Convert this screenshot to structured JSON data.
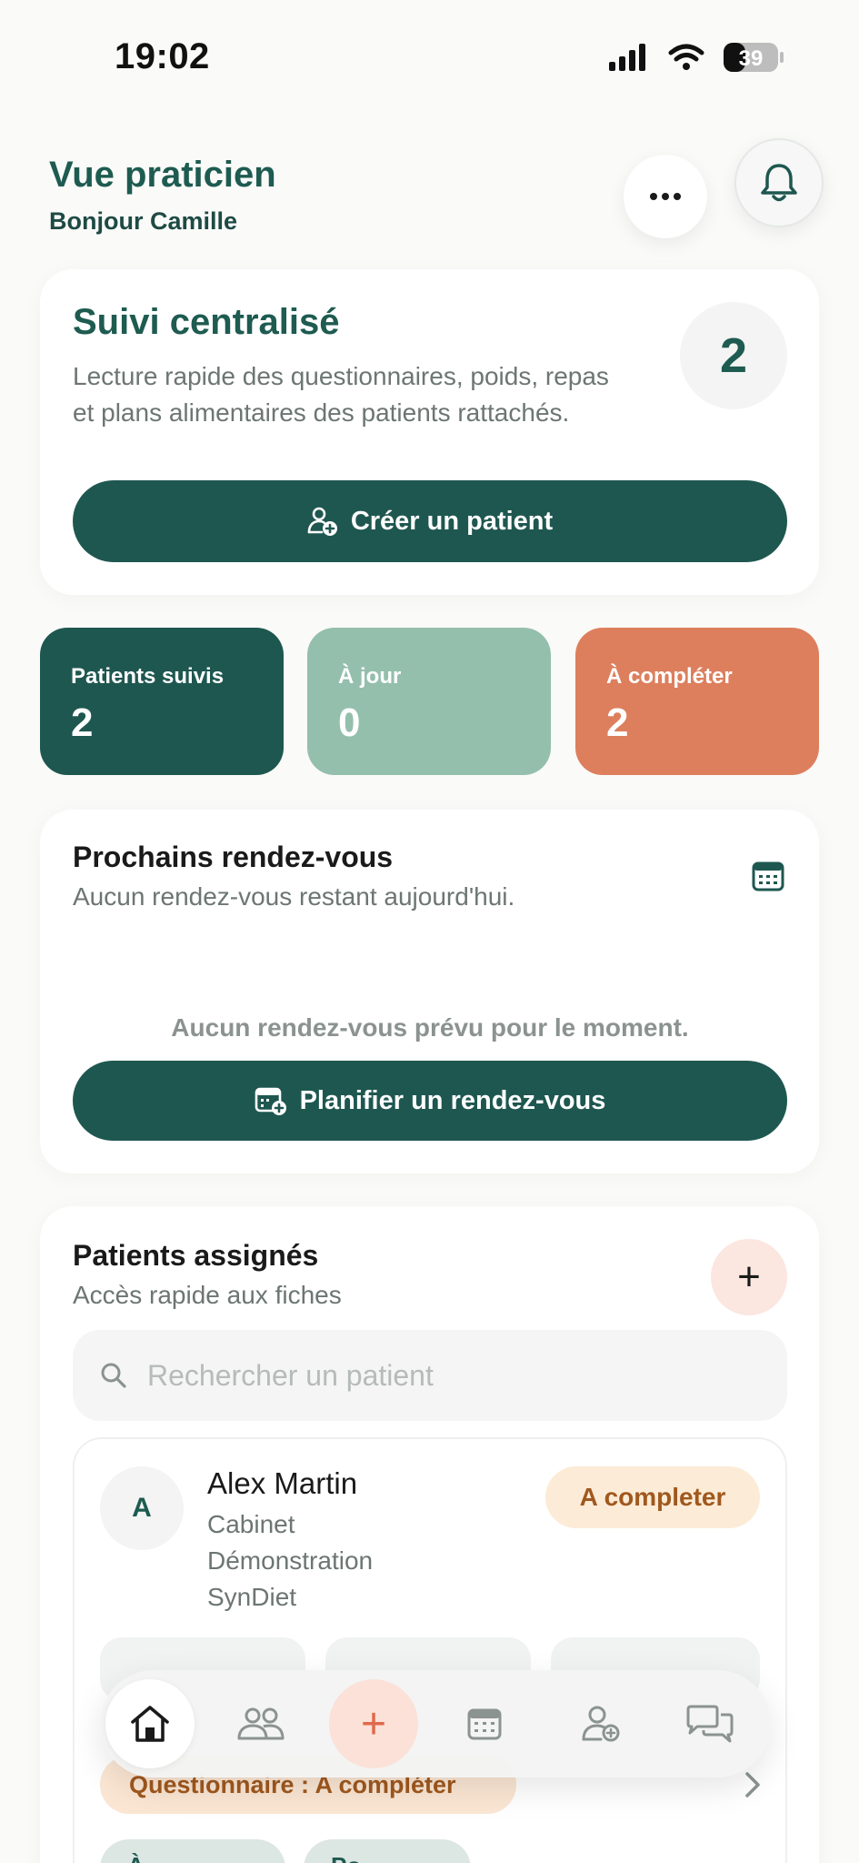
{
  "status_bar": {
    "time": "19:02",
    "battery": "39"
  },
  "header": {
    "title": "Vue praticien",
    "greeting": "Bonjour Camille"
  },
  "summary_card": {
    "title": "Suivi centralisé",
    "description": "Lecture rapide des questionnaires, poids, repas et plans alimentaires des patients rattachés.",
    "count": "2",
    "create_patient_label": "Créer un patient"
  },
  "stats": [
    {
      "label": "Patients suivis",
      "value": "2",
      "color": "#1E5750"
    },
    {
      "label": "À jour",
      "value": "0",
      "color": "#94BFAD"
    },
    {
      "label": "À compléter",
      "value": "2",
      "color": "#DD7F5D"
    }
  ],
  "appointments": {
    "title": "Prochains rendez-vous",
    "subtitle": "Aucun rendez-vous restant aujourd'hui.",
    "empty_message": "Aucun rendez-vous prévu pour le moment.",
    "plan_label": "Planifier un rendez-vous"
  },
  "patients": {
    "title": "Patients assignés",
    "subtitle": "Accès rapide aux fiches",
    "add_label": "+",
    "search_placeholder": "Rechercher un patient",
    "list": [
      {
        "initial": "A",
        "name": "Alex Martin",
        "org_lines": [
          "Cabinet",
          "Démonstration",
          "SynDiet"
        ],
        "status": "A completer",
        "questionnaire": "Questionnaire : A compléter",
        "chips": [
          "À ...",
          "Po..."
        ]
      }
    ]
  },
  "bottom_nav": {
    "items": [
      "home-icon",
      "patients-icon",
      "plus-icon",
      "calendar-icon",
      "add-user-icon",
      "chat-icon"
    ],
    "active": "home-icon",
    "add_symbol": "+"
  },
  "colors": {
    "brand": "#1E5750",
    "accent": "#E0694B",
    "warning_bg": "#FCEBD6",
    "warning_text": "#A0581E"
  }
}
